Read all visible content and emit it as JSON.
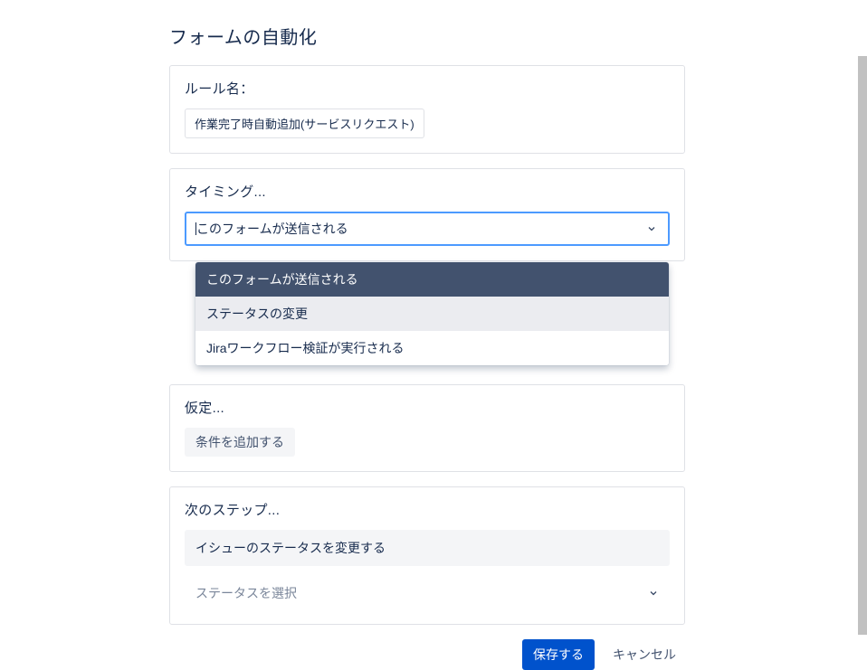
{
  "page": {
    "title": "フォームの自動化"
  },
  "rule": {
    "label": "ルール名：",
    "value": "作業完了時自動追加(サービスリクエスト)"
  },
  "timing": {
    "label": "タイミング...",
    "selected": "このフォームが送信される",
    "options": [
      "このフォームが送信される",
      "ステータスの変更",
      "Jiraワークフロー検証が実行される"
    ]
  },
  "assumption": {
    "label": "仮定...",
    "add_condition": "条件を追加する"
  },
  "next_step": {
    "label": "次のステップ...",
    "action": "イシューのステータスを変更する",
    "status_placeholder": "ステータスを選択"
  },
  "footer": {
    "save": "保存する",
    "cancel": "キャンセル"
  }
}
